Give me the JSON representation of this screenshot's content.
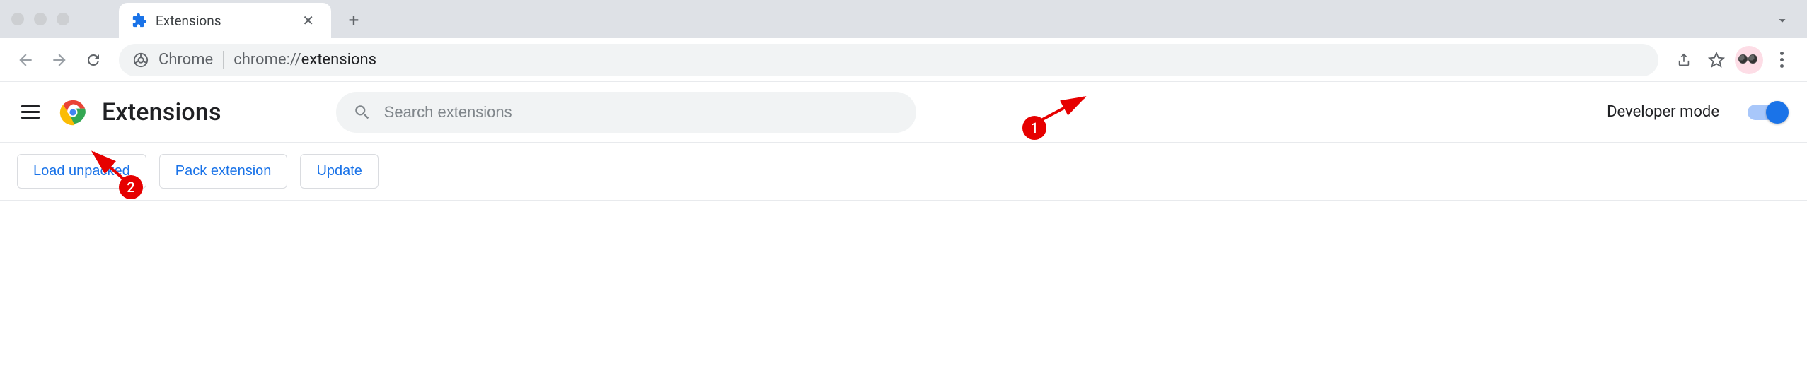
{
  "tab": {
    "title": "Extensions"
  },
  "omnibox": {
    "host": "Chrome",
    "path_prefix": "chrome://",
    "path_bold": "extensions"
  },
  "page": {
    "title": "Extensions"
  },
  "search": {
    "placeholder": "Search extensions"
  },
  "dev_mode": {
    "label": "Developer mode",
    "enabled": true
  },
  "actions": {
    "load_unpacked": "Load unpacked",
    "pack_extension": "Pack extension",
    "update": "Update"
  },
  "annotations": {
    "badge1": "1",
    "badge2": "2"
  },
  "colors": {
    "accent": "#1a73e8",
    "annotation": "#e60000"
  }
}
